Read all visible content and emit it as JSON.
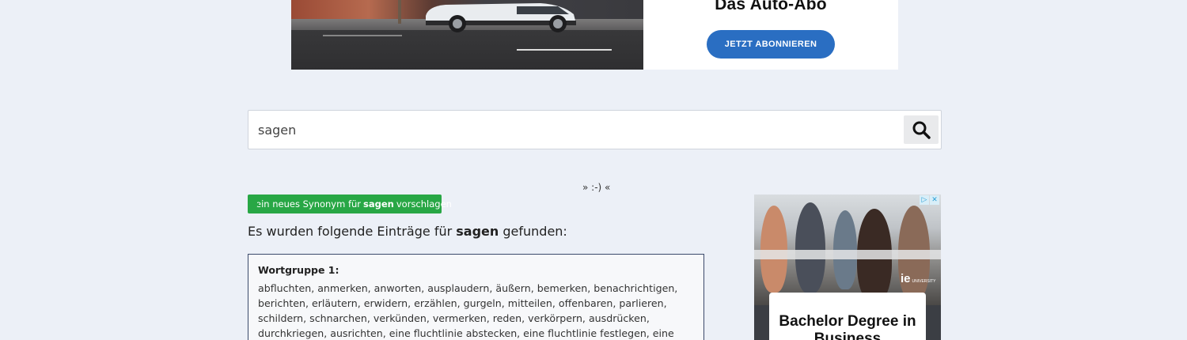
{
  "top_ad": {
    "title": "Das Auto-Abo",
    "button_label": "JETZT ABONNIEREN",
    "accent_color": "#2a6ec2"
  },
  "search": {
    "value": "sagen",
    "button_icon": "search-icon"
  },
  "smiley": "» :-) «",
  "suggest": {
    "prefix": "ein neues Synonym für",
    "term": "sagen",
    "suffix": "vorschlagen",
    "icon": "plus-square-icon",
    "color": "#28a745"
  },
  "results": {
    "prefix": "Es wurden folgende Einträge für",
    "term": "sagen",
    "suffix": "gefunden:"
  },
  "word_groups": [
    {
      "title": "Wortgruppe 1:",
      "words": "abfluchten, anmerken, anworten, ausplaudern, äußern, bemerken, benachrichtigen, berichten, erläutern, erwidern, erzählen, gurgeln, mitteilen, offenbaren, parlieren, schildern, schnarchen, verkünden, vermerken, reden, verkörpern, ausdrücken, durchkriegen, ausrichten, eine fluchtlinie abstecken, eine fluchtlinie festlegen, eine gerade linie bilden,"
    }
  ],
  "side_ad": {
    "headline": "Bachelor Degree in Business",
    "logo": "ie",
    "logo_sub": "UNIVERSITY",
    "choices_play": "▷",
    "choices_close": "✕"
  }
}
